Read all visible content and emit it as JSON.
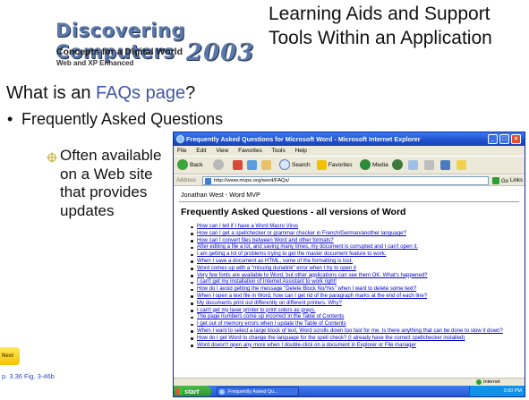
{
  "slide": {
    "logo": {
      "brand": "Discovering Computers",
      "year": "2003",
      "tagline": "Concepts for a Digital World",
      "edition": "Web and XP Enhanced"
    },
    "title": "Learning Aids and Support Tools Within an Application",
    "subtitle_prefix": "What is an ",
    "subtitle_highlight": "FAQs page",
    "subtitle_suffix": "?",
    "bullet": "Frequently Asked  Questions",
    "sub_bullet": "Often available on a Web site that provides updates",
    "next_label": "Next",
    "page_ref": "p. 3.36 Fig. 3-46b",
    "colors": {
      "highlight": "#3f57a8",
      "logo_blue": "#5a78a8",
      "link": "#0000cc",
      "xp_title": "#1f4fcc"
    }
  },
  "browser": {
    "window_title": "Frequently Asked Questions for Microsoft Word - Microsoft Internet Explorer",
    "menu": [
      "File",
      "Edit",
      "View",
      "Favorites",
      "Tools",
      "Help"
    ],
    "toolbar": {
      "back": "Back",
      "search": "Search",
      "favorites": "Favorites",
      "media": "Media"
    },
    "address_label": "Address",
    "url": "http://www.mvps.org/word/FAQs/",
    "go_label": "Go",
    "links_label": "Links",
    "author": "Jonathan West - Word MVP",
    "heading": "Frequently Asked Questions - all versions of Word",
    "faq_items": [
      "How can I tell if I have a Word Macro Virus",
      "How can I get a spellchecker or grammar checker in French/German/another language?",
      "How can I convert files between Word and other formats?",
      "After editing a file a lot, and saving many times, my document is corrupted and I can't open it.",
      "I am getting a lot of problems trying to get the master document feature to work.",
      "When I save a document as HTML, some of the formatting is lost.",
      "Word comes up with a \"missing dunalink\" error when I try to open it",
      "Very few fonts are available to Word, but other applications can see them OK. What's happened?",
      "I can't get my installation of Internet Assistant to work right!",
      "How do I avoid getting the message \"Delete Block No/Yes\" when I want to delete some text?",
      "When I open a text file in Word, how can I get rid of the paragraph marks at the end of each line?",
      "My documents print out differently on different printers. Why?",
      "I can't get my laser printer to print colors as grays.",
      "The page numbers come up incorrect in the Table of Contents",
      "I get out of memory errors when I update the Table of Contents",
      "When I want to select a large block of text, Word scrolls down too fast for me. Is there anything that can be done to slow it down?",
      "How do I get Word to change the language for the spell check? (I already have the correct spellchecker installed)",
      "Word doesn't open any more when I double-click on a document in Explorer or File manager"
    ],
    "status_zone": "Internet",
    "taskbar": {
      "start": "start",
      "task": "Frequently Asked Qu...",
      "clock": "3:00 PM"
    }
  }
}
